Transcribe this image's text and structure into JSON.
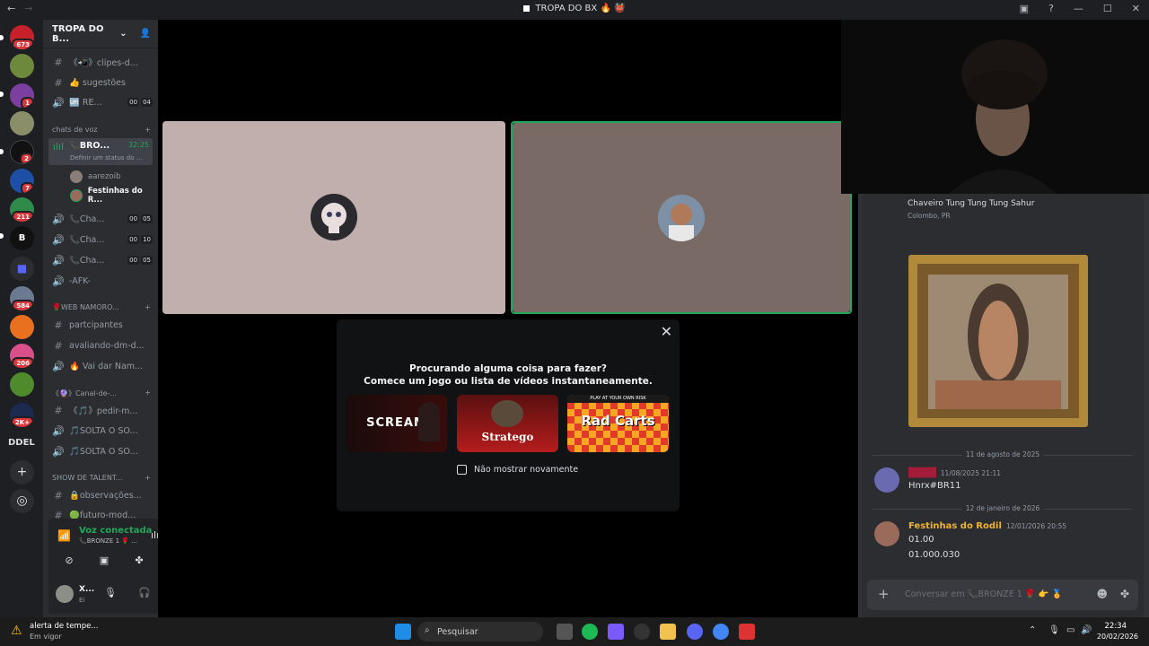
{
  "titlebar": {
    "title": "TROPA DO BX",
    "back": "←",
    "forward": "→"
  },
  "servers": [
    {
      "badge": "673"
    },
    {
      "badge": ""
    },
    {
      "badge": "1"
    },
    {
      "badge": ""
    },
    {
      "badge": "2"
    },
    {
      "badge": "7"
    },
    {
      "badge": "211"
    },
    {
      "badge": ""
    },
    {
      "badge": ""
    },
    {
      "badge": "584"
    },
    {
      "badge": ""
    },
    {
      "badge": "206"
    },
    {
      "badge": ""
    },
    {
      "badge": "2K+"
    }
  ],
  "rail": {
    "label": "DDEL",
    "add": "+",
    "explore": "◎"
  },
  "guild": {
    "name": "TROPA DO B...",
    "chevron": "⌄"
  },
  "channels": {
    "clipes": "《📲》clipes-d...",
    "sugestoes": "👍 sugestões",
    "re": "🆙 RE...",
    "re_count_a": "00",
    "re_count_b": "04",
    "cat_voice": "chats de voz",
    "bronze": "📞BRO...",
    "bronze_time": "32:25",
    "bronze_status": "Definir um status do ...",
    "member1": "aarezoib",
    "member2": "Festinhas do R...",
    "cha1": "📞Cha...",
    "cha1_a": "00",
    "cha1_b": "05",
    "cha2": "📞Cha...",
    "cha2_a": "00",
    "cha2_b": "10",
    "cha3": "📞Cha...",
    "cha3_a": "00",
    "cha3_b": "05",
    "afk": "-AFK-",
    "cat_web": "🌹WEB NAMORO...",
    "participantes": "partcipantes",
    "avaliando": "avaliando-dm-d...",
    "vaidar": "🔥 Vai dar Nam...",
    "cat_canal": "《🔮》Canal-de-...",
    "pedir": "《🎵》pedir-m...",
    "solta1": "🎵SOLTA O SO...",
    "solta2": "🎵SOLTA O SO...",
    "cat_talent": "SHOW DE TALENT...",
    "observacoes": "🔒observações...",
    "futuro": "🟢futuro-mod..."
  },
  "voice": {
    "status": "Voz conectada",
    "sub": "📞BRONZE 1 🌹 ..."
  },
  "user": {
    "name": "X...",
    "status": "Ei"
  },
  "modal": {
    "line1": "Procurando alguma coisa para fazer?",
    "line2": "Comece um jogo ou lista de vídeos instantaneamente.",
    "close": "✕",
    "game1": "SCREAM",
    "game2": "Stratego",
    "game3": "Rad Carts",
    "game3_top": "PLAY AT YOUR OWN RISK",
    "checkbox": "Não mostrar novamente"
  },
  "chat": {
    "prev_name": "Chaveiro Tung Tung Tung Sahur",
    "prev_loc": "Colombo, PR",
    "date1": "11 de agosto de 2025",
    "msg1_author": "████",
    "msg1_time": "11/08/2025 21:11",
    "msg1_text": "Hnrx#BR11",
    "date2": "12 de janeiro de 2026",
    "msg2_author": "Festinhas do Rodil",
    "msg2_time": "12/01/2026 20:55",
    "msg2_line1": "01.00",
    "msg2_line2": "01.000.030",
    "input_placeholder": "Conversar em 📞BRONZE 1 🌹 👉 🏅"
  },
  "taskbar": {
    "weather_title": "alerta de tempe...",
    "weather_sub": "Em vigor",
    "search": "Pesquisar",
    "time": "22:34",
    "date": "20/02/2026"
  },
  "colors": {
    "accent_green": "#23a55a",
    "tile_left": "#c0afad",
    "tile_right": "#7a6a66",
    "msg2_author": "#f0b232"
  }
}
